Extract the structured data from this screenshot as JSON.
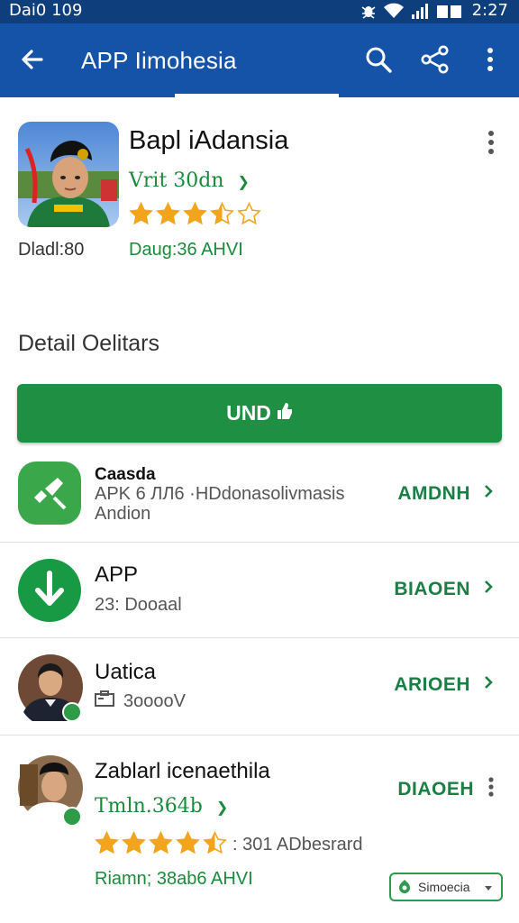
{
  "status_bar": {
    "time_left": "Dai0 109",
    "time_right": "2:27"
  },
  "app_bar": {
    "title": "APP Iimohesia"
  },
  "header": {
    "title": "Bapl iAdansia",
    "subtitle": "Vrit 30dn",
    "subtitle_chevron": "❯",
    "rating": 3.5,
    "left_meta": "Dladl:80",
    "right_meta": "Daug:36 AHVI"
  },
  "section": {
    "title": "Detail Oelitars"
  },
  "install_button": {
    "label": "UND"
  },
  "list": [
    {
      "title": "Caasda",
      "sub1": "APK 6 ЛЛ6 ·HDdonasolivmasis",
      "sub2": "Andion",
      "action": "AMDNH"
    },
    {
      "title": "APP",
      "sub1": "23: Dooaal",
      "action": "BIAOEN"
    },
    {
      "title": "Uatica",
      "sub1": "3ooooV",
      "action": "ARIOEH"
    },
    {
      "title": "Zablarl icenaethila",
      "sub1": "Tmln.364b",
      "sub1_chevron": "❯",
      "rating": 4.5,
      "rating_text": ": 301  ADbesrard",
      "sub2": "Riamn; 38ab6 AHVI",
      "action": "DIAOEH"
    }
  ],
  "dropdown": {
    "label": "Simoecia"
  },
  "colors": {
    "status_bar": "#0e3f7c",
    "app_bar": "#1553a8",
    "accent_green": "#1f8f44",
    "star": "#f2a51c"
  }
}
